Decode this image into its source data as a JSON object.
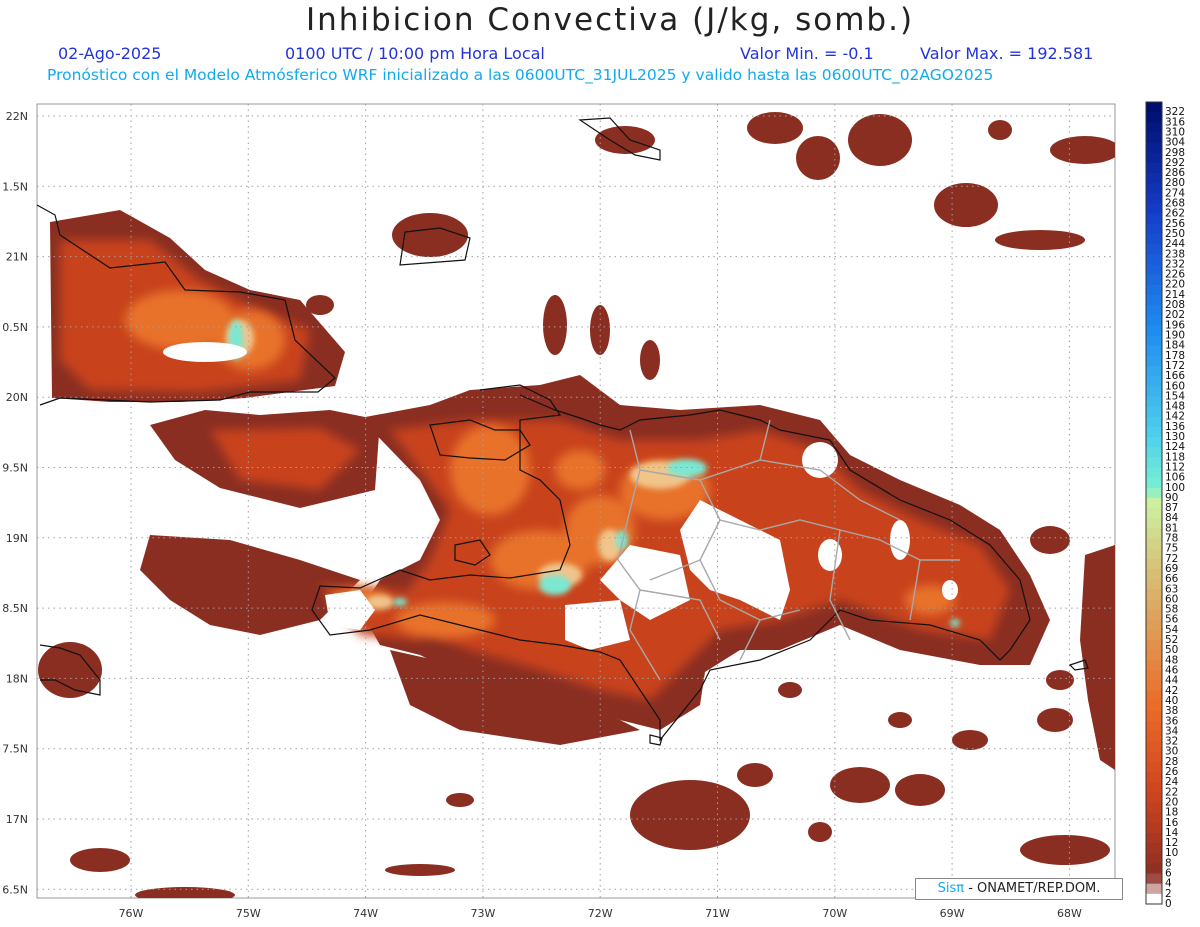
{
  "header": {
    "title": "Inhibicion Convectiva (J/kg, somb.)",
    "date": "02-Ago-2025",
    "time": "0100 UTC / 10:00 pm Hora Local",
    "min_label": "Valor Min. = -0.1",
    "max_label": "Valor Max. = 192.581",
    "run_info": "Pronóstico con el Modelo Atmósferico WRF inicializado a las 0600UTC_31JUL2025 y valido hasta las  0600UTC_02AGO2025"
  },
  "map": {
    "lon_range": [
      -76.8,
      -67.6
    ],
    "lat_range": [
      16.4,
      22.15
    ],
    "lat_labels": [
      "22N",
      "1.5N",
      "21N",
      "0.5N",
      "20N",
      "9.5N",
      "19N",
      "8.5N",
      "18N",
      "7.5N",
      "17N",
      "6.5N"
    ],
    "lon_labels": [
      "76W",
      "75W",
      "74W",
      "73W",
      "72W",
      "71W",
      "70W",
      "69W",
      "68W"
    ],
    "colors": {
      "low": "#8a2e22",
      "mid": "#c8431f",
      "high": "#e86a22",
      "cyan": "#7ae8d2",
      "coast": "#111111",
      "province": "#a8a8a8"
    }
  },
  "colorbar": {
    "ticks": [
      "322",
      "316",
      "310",
      "304",
      "298",
      "292",
      "286",
      "280",
      "274",
      "268",
      "262",
      "256",
      "250",
      "244",
      "238",
      "232",
      "226",
      "220",
      "214",
      "208",
      "202",
      "196",
      "190",
      "184",
      "178",
      "172",
      "166",
      "160",
      "154",
      "148",
      "142",
      "136",
      "130",
      "124",
      "118",
      "112",
      "106",
      "100",
      "90",
      "87",
      "84",
      "81",
      "78",
      "75",
      "72",
      "69",
      "66",
      "63",
      "60",
      "58",
      "56",
      "54",
      "52",
      "50",
      "48",
      "46",
      "44",
      "42",
      "40",
      "38",
      "36",
      "34",
      "32",
      "30",
      "28",
      "26",
      "24",
      "22",
      "20",
      "18",
      "16",
      "14",
      "12",
      "10",
      "8",
      "6",
      "4",
      "2",
      "0"
    ]
  },
  "credit": {
    "sis": "Sisπ",
    "rest": " - ONAMET/REP.DOM."
  }
}
